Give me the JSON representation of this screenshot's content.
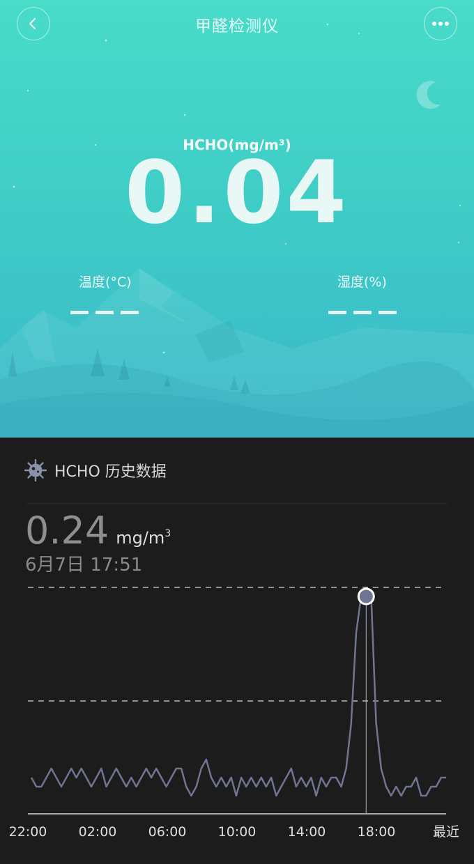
{
  "header": {
    "title": "甲醛检测仪",
    "back_icon": "chevron-left-icon",
    "more_icon": "more-dots-icon"
  },
  "current": {
    "unit_label": "HCHO(mg/m³)",
    "value": "0.04"
  },
  "metrics": {
    "temperature": {
      "label": "温度(°C)",
      "value": "---"
    },
    "humidity": {
      "label": "湿度(%)",
      "value": "---"
    }
  },
  "history": {
    "icon": "sensor-icon",
    "title": "HCHO 历史数据",
    "selected_value": "0.24",
    "selected_unit": "mg/m",
    "selected_unit_sup": "3",
    "selected_time": "6月7日 17:51"
  },
  "colors": {
    "hero_top": "#49dcc9",
    "hero_bottom": "#3ab8c9",
    "line": "#6f7590",
    "panel": "#1c1c1c"
  },
  "chart_data": {
    "type": "line",
    "categories": [
      "22:00",
      "02:00",
      "06:00",
      "10:00",
      "14:00",
      "18:00",
      "最近"
    ],
    "series": [
      {
        "values": [
          0.04,
          0.03,
          0.03,
          0.04,
          0.05,
          0.04,
          0.03,
          0.04,
          0.05,
          0.04,
          0.05,
          0.04,
          0.03,
          0.04,
          0.05,
          0.03,
          0.04,
          0.05,
          0.04,
          0.03,
          0.04,
          0.03,
          0.04,
          0.05,
          0.04,
          0.05,
          0.04,
          0.03,
          0.04,
          0.05,
          0.05,
          0.03,
          0.02,
          0.03,
          0.05,
          0.06,
          0.04,
          0.03,
          0.04,
          0.03,
          0.04,
          0.02,
          0.04,
          0.03,
          0.04,
          0.03,
          0.04,
          0.03,
          0.04,
          0.02,
          0.03,
          0.04,
          0.05,
          0.03,
          0.04,
          0.03,
          0.04,
          0.02,
          0.04,
          0.03,
          0.04,
          0.04,
          0.03,
          0.05,
          0.1,
          0.2,
          0.24,
          0.24,
          0.24,
          0.1,
          0.05,
          0.03,
          0.02,
          0.03,
          0.02,
          0.03,
          0.03,
          0.04,
          0.02,
          0.02,
          0.03,
          0.03,
          0.04,
          0.04
        ]
      }
    ],
    "ylim": [
      0,
      0.25
    ],
    "selected_index": 67
  }
}
